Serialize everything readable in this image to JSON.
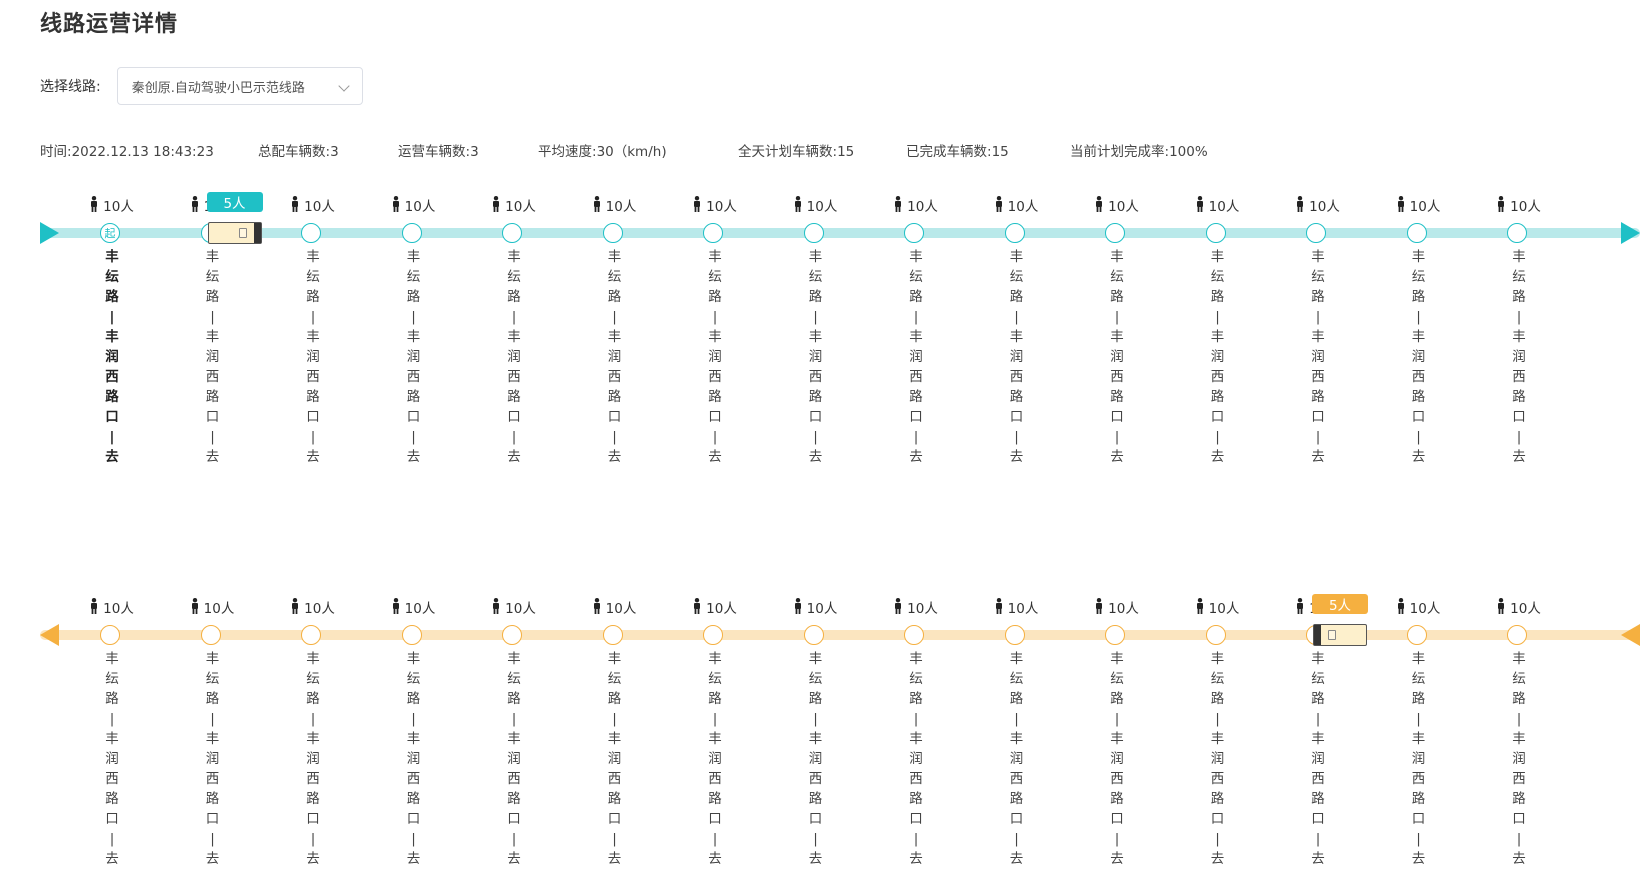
{
  "page": {
    "title": "线路运营详情"
  },
  "route_select": {
    "label": "选择线路:",
    "value": "秦创原.自动驾驶小巴示范线路"
  },
  "stats": [
    {
      "label": "时间:",
      "value": "2022.12.13  18:43:23"
    },
    {
      "label": "总配车辆数:",
      "value": "3"
    },
    {
      "label": "运营车辆数:",
      "value": "3"
    },
    {
      "label": "平均速度:",
      "value": "30（km/h)"
    },
    {
      "label": "全天计划车辆数:",
      "value": "15"
    },
    {
      "label": "已完成车辆数:",
      "value": "15"
    },
    {
      "label": "当前计划完成率:",
      "value": "100%"
    }
  ],
  "colors": {
    "outbound_track": "#b9e9ea",
    "outbound_accent": "#1fc0c6",
    "inbound_track": "#fbe5bf",
    "inbound_accent": "#f5b040"
  },
  "outbound": {
    "start_marker": "起",
    "stations": [
      {
        "count": "10人",
        "name": "丰\n纭\n路\n|\n丰\n润\n西\n路\n口\n|\n去"
      },
      {
        "count": "10人",
        "name": "丰\n纭\n路\n|\n丰\n润\n西\n路\n口\n|\n去"
      },
      {
        "count": "10人",
        "name": "丰\n纭\n路\n|\n丰\n润\n西\n路\n口\n|\n去"
      },
      {
        "count": "10人",
        "name": "丰\n纭\n路\n|\n丰\n润\n西\n路\n口\n|\n去"
      },
      {
        "count": "10人",
        "name": "丰\n纭\n路\n|\n丰\n润\n西\n路\n口\n|\n去"
      },
      {
        "count": "10人",
        "name": "丰\n纭\n路\n|\n丰\n润\n西\n路\n口\n|\n去"
      },
      {
        "count": "10人",
        "name": "丰\n纭\n路\n|\n丰\n润\n西\n路\n口\n|\n去"
      },
      {
        "count": "10人",
        "name": "丰\n纭\n路\n|\n丰\n润\n西\n路\n口\n|\n去"
      },
      {
        "count": "10人",
        "name": "丰\n纭\n路\n|\n丰\n润\n西\n路\n口\n|\n去"
      },
      {
        "count": "10人",
        "name": "丰\n纭\n路\n|\n丰\n润\n西\n路\n口\n|\n去"
      },
      {
        "count": "10人",
        "name": "丰\n纭\n路\n|\n丰\n润\n西\n路\n口\n|\n去"
      },
      {
        "count": "10人",
        "name": "丰\n纭\n路\n|\n丰\n润\n西\n路\n口\n|\n去"
      },
      {
        "count": "10人",
        "name": "丰\n纭\n路\n|\n丰\n润\n西\n路\n口\n|\n去"
      },
      {
        "count": "10人",
        "name": "丰\n纭\n路\n|\n丰\n润\n西\n路\n口\n|\n去"
      },
      {
        "count": "10人",
        "name": "丰\n纭\n路\n|\n丰\n润\n西\n路\n口\n|\n去"
      }
    ],
    "bus": {
      "passengers": "5人",
      "after_station": 1
    }
  },
  "inbound": {
    "stations": [
      {
        "count": "10人",
        "name": "丰\n纭\n路\n|\n丰\n润\n西\n路\n口\n|\n去"
      },
      {
        "count": "10人",
        "name": "丰\n纭\n路\n|\n丰\n润\n西\n路\n口\n|\n去"
      },
      {
        "count": "10人",
        "name": "丰\n纭\n路\n|\n丰\n润\n西\n路\n口\n|\n去"
      },
      {
        "count": "10人",
        "name": "丰\n纭\n路\n|\n丰\n润\n西\n路\n口\n|\n去"
      },
      {
        "count": "10人",
        "name": "丰\n纭\n路\n|\n丰\n润\n西\n路\n口\n|\n去"
      },
      {
        "count": "10人",
        "name": "丰\n纭\n路\n|\n丰\n润\n西\n路\n口\n|\n去"
      },
      {
        "count": "10人",
        "name": "丰\n纭\n路\n|\n丰\n润\n西\n路\n口\n|\n去"
      },
      {
        "count": "10人",
        "name": "丰\n纭\n路\n|\n丰\n润\n西\n路\n口\n|\n去"
      },
      {
        "count": "10人",
        "name": "丰\n纭\n路\n|\n丰\n润\n西\n路\n口\n|\n去"
      },
      {
        "count": "10人",
        "name": "丰\n纭\n路\n|\n丰\n润\n西\n路\n口\n|\n去"
      },
      {
        "count": "10人",
        "name": "丰\n纭\n路\n|\n丰\n润\n西\n路\n口\n|\n去"
      },
      {
        "count": "10人",
        "name": "丰\n纭\n路\n|\n丰\n润\n西\n路\n口\n|\n去"
      },
      {
        "count": "10人",
        "name": "丰\n纭\n路\n|\n丰\n润\n西\n路\n口\n|\n去"
      },
      {
        "count": "10人",
        "name": "丰\n纭\n路\n|\n丰\n润\n西\n路\n口\n|\n去"
      },
      {
        "count": "10人",
        "name": "丰\n纭\n路\n|\n丰\n润\n西\n路\n口\n|\n去"
      }
    ],
    "bus": {
      "passengers": "5人",
      "after_station": 12
    }
  }
}
